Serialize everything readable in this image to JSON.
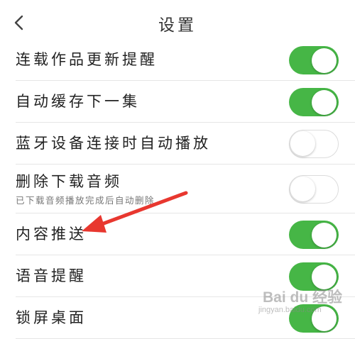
{
  "header": {
    "title": "设置"
  },
  "settings": {
    "items": [
      {
        "label": "连载作品更新提醒",
        "enabled": true
      },
      {
        "label": "自动缓存下一集",
        "enabled": true
      },
      {
        "label": "蓝牙设备连接时自动播放",
        "enabled": false
      },
      {
        "label": "删除下载音频",
        "sublabel": "已下载音频播放完成后自动删除",
        "enabled": false
      },
      {
        "label": "内容推送",
        "enabled": true
      },
      {
        "label": "语音提醒",
        "enabled": true
      },
      {
        "label": "锁屏桌面",
        "enabled": true
      }
    ]
  },
  "annotation": {
    "arrow_color": "#e8372f",
    "target": "内容推送"
  },
  "watermark": {
    "brand": "Bai du 经验",
    "url": "jingyan.baidu.com"
  },
  "colors": {
    "toggle_on": "#46b646",
    "toggle_off_border": "#dcdcdc"
  }
}
